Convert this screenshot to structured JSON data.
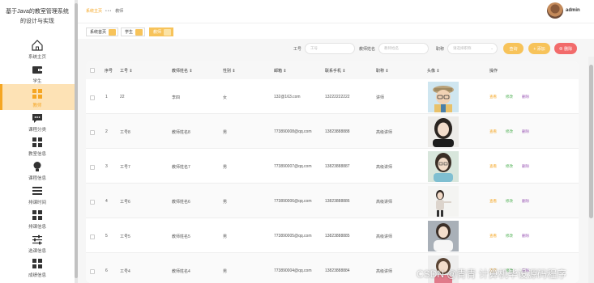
{
  "app": {
    "title_line1": "基于Java的教室管理系统",
    "title_line2": "的设计与实现"
  },
  "sidebar": {
    "items": [
      {
        "label": "系统主页",
        "icon": "home-icon"
      },
      {
        "label": "学生",
        "icon": "wallet-icon"
      },
      {
        "label": "教师",
        "icon": "grid-icon",
        "active": true
      },
      {
        "label": "课程分类",
        "icon": "chat-icon"
      },
      {
        "label": "教室信息",
        "icon": "grid-icon"
      },
      {
        "label": "课程信息",
        "icon": "bulb-icon"
      },
      {
        "label": "排课时间",
        "icon": "list-icon"
      },
      {
        "label": "排课信息",
        "icon": "grid-icon"
      },
      {
        "label": "选课信息",
        "icon": "sliders-icon"
      },
      {
        "label": "成绩信息",
        "icon": "grid-icon"
      }
    ]
  },
  "breadcrumb": {
    "home": "系统主页",
    "sep": "•••",
    "current": "教师"
  },
  "user": {
    "name": "admin"
  },
  "tabs": [
    {
      "label": "系统首页"
    },
    {
      "label": "学生"
    },
    {
      "label": "教师",
      "active": true
    }
  ],
  "search": {
    "field1_label": "工号",
    "field1_placeholder": "工号",
    "field2_label": "教师姓名",
    "field2_placeholder": "教师姓名",
    "field3_label": "职称",
    "field3_placeholder": "请选择职称",
    "query_btn": "查询",
    "add_btn": "+ 添加",
    "delete_btn": "⊗ 删除"
  },
  "table": {
    "headers": [
      "序号",
      "工号 ⇕",
      "教师姓名 ⇕",
      "性别 ⇕",
      "邮箱 ⇕",
      "联系手机 ⇕",
      "职称 ⇕",
      "头像 ⇕",
      "操作"
    ],
    "actions": {
      "view": "查看",
      "edit": "修改",
      "delete": "删除"
    },
    "rows": [
      {
        "no": "1",
        "id": "22",
        "name": "李四",
        "gender": "女",
        "email": "132@163.com",
        "phone": "13222222222",
        "title": "讲师"
      },
      {
        "no": "2",
        "id": "工号8",
        "name": "教师姓名8",
        "gender": "男",
        "email": "773890008@qq.com",
        "phone": "13823888888",
        "title": "高级讲师"
      },
      {
        "no": "3",
        "id": "工号7",
        "name": "教师姓名7",
        "gender": "男",
        "email": "773890007@qq.com",
        "phone": "13823888887",
        "title": "高级讲师"
      },
      {
        "no": "4",
        "id": "工号6",
        "name": "教师姓名6",
        "gender": "男",
        "email": "773890006@qq.com",
        "phone": "13823888886",
        "title": "高级讲师"
      },
      {
        "no": "5",
        "id": "工号5",
        "name": "教师姓名5",
        "gender": "男",
        "email": "773890005@qq.com",
        "phone": "13823888885",
        "title": "高级讲师"
      },
      {
        "no": "6",
        "id": "工号4",
        "name": "教师姓名4",
        "gender": "男",
        "email": "773890004@qq.com",
        "phone": "13823888884",
        "title": "高级讲师"
      }
    ]
  },
  "watermark": "CSDN @青青  计算机毕设源码程序",
  "colors": {
    "accent": "#f5a623",
    "edit": "#4caf50",
    "delete": "#9b59b6",
    "danger": "#f26b6b"
  }
}
